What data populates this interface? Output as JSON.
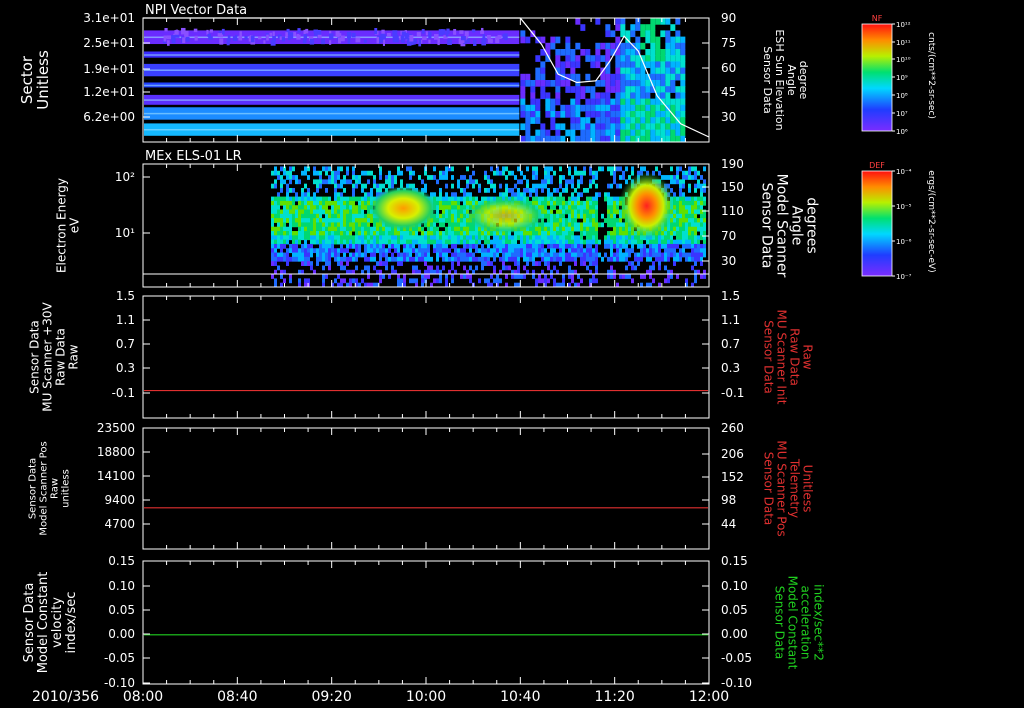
{
  "chart_data": [
    {
      "type": "heatmap",
      "title": "NPI Vector Data",
      "ylabel_left": [
        "Sector",
        "Unitless"
      ],
      "yticks_left": [
        "3.1e+01",
        "2.5e+01",
        "1.9e+01",
        "1.2e+01",
        "6.2e+00"
      ],
      "ylabel_right": [
        "Sensor Data",
        "ESH Sun Elevation",
        "Angle",
        "degree"
      ],
      "yticks_right": [
        "90",
        "75",
        "60",
        "45",
        "30"
      ],
      "colorbar": {
        "label": "NF",
        "units": "cnts/(cm**2-sr-sec)",
        "ticks": [
          "10¹²",
          "10¹¹",
          "10¹⁰",
          "10⁹",
          "10⁸",
          "10⁷",
          "10⁶"
        ]
      },
      "overlay_line": {
        "name": "ESH Sun Elevation Angle",
        "x": [
          "08:00",
          "10:40",
          "10:49",
          "10:56",
          "11:04",
          "11:12",
          "11:18",
          "11:24",
          "11:30",
          "11:38",
          "11:48",
          "12:00"
        ],
        "y": [
          90,
          90,
          74,
          56,
          51,
          52,
          64,
          79,
          70,
          43,
          26,
          18
        ]
      }
    },
    {
      "type": "heatmap",
      "title": "MEx ELS-01 LR",
      "ylabel_left": [
        "Electron Energy",
        "eV"
      ],
      "yticks_left": [
        "10²",
        "10¹"
      ],
      "ylabel_right": [
        "Sensor Data",
        "Model Scanner",
        "Angle",
        "degrees"
      ],
      "yticks_right": [
        "190",
        "150",
        "110",
        "70",
        "30"
      ],
      "colorbar": {
        "label": "DEF",
        "units": "ergs/(cm**2-sr-sec-eV)",
        "ticks": [
          "10⁻⁴",
          "10⁻⁵",
          "10⁻⁶",
          "10⁻⁷"
        ]
      }
    },
    {
      "type": "line",
      "ylabel_left": [
        "Sensor Data",
        "MU Scanner +30V",
        "Raw Data",
        "Raw"
      ],
      "yticks_left": [
        "1.5",
        "1.1",
        "0.7",
        "0.3",
        "-0.1"
      ],
      "ylabel_right": [
        "Sensor Data",
        "MU Scanner Init",
        "Raw Data",
        "Raw"
      ],
      "yticks_right": [
        "1.5",
        "1.1",
        "0.7",
        "0.3",
        "-0.1"
      ],
      "ylim": [
        -0.5,
        1.5
      ],
      "series": [
        {
          "color": "#e03030",
          "y": -0.05
        }
      ]
    },
    {
      "type": "line",
      "ylabel_left": [
        "Sensor Data",
        "Model Scanner Pos",
        "Raw",
        "unitless"
      ],
      "yticks_left": [
        "23500",
        "18800",
        "14100",
        "9400",
        "4700"
      ],
      "ylabel_right": [
        "Sensor Data",
        "MU Scanner Pos",
        "Telemetry",
        "Unitless"
      ],
      "yticks_right": [
        "260",
        "206",
        "152",
        "98",
        "44"
      ],
      "ylim": [
        0,
        23500
      ],
      "series": [
        {
          "color": "#e03030",
          "y": 8000
        }
      ]
    },
    {
      "type": "line",
      "ylabel_left": [
        "Sensor Data",
        "Model Constant",
        "velocity",
        "index/sec"
      ],
      "yticks_left": [
        "0.15",
        "0.10",
        "0.05",
        "0.00",
        "-0.05",
        "-0.10"
      ],
      "ylabel_right": [
        "Sensor Data",
        "Model Constant",
        "acceleration",
        "index/sec**2"
      ],
      "yticks_right": [
        "0.15",
        "0.10",
        "0.05",
        "0.00",
        "-0.05",
        "-0.10"
      ],
      "ylim": [
        -0.1,
        0.15
      ],
      "series": [
        {
          "color": "#20d020",
          "y": 0.0
        }
      ]
    }
  ],
  "xaxis": {
    "date": "2010/356",
    "ticks": [
      "08:00",
      "08:40",
      "09:20",
      "10:00",
      "10:40",
      "11:20",
      "12:00"
    ]
  },
  "colors": {
    "bg": "#000000",
    "fg": "#ffffff",
    "red": "#e03030",
    "green": "#20d020"
  }
}
